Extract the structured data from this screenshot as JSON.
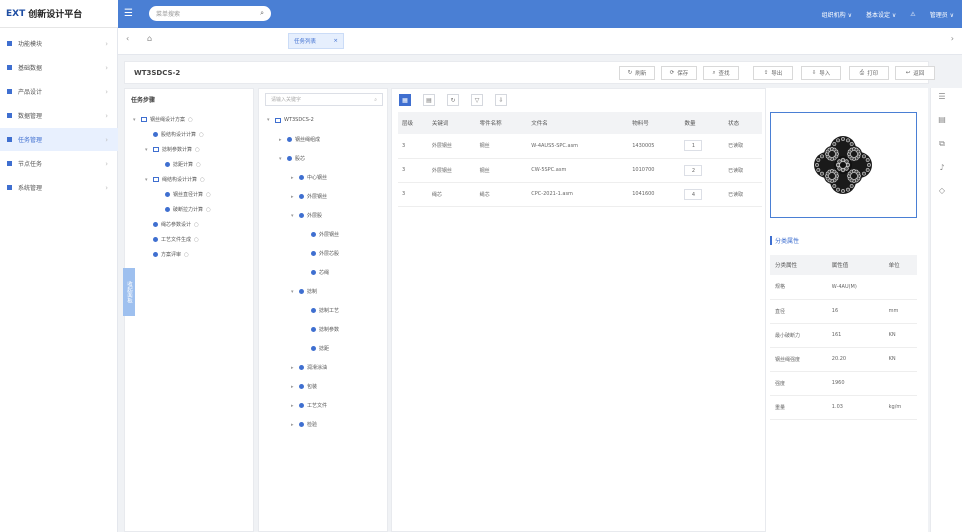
{
  "app": {
    "logo_mark": "EXT",
    "title": "创新设计平台"
  },
  "search": {
    "placeholder": "菜单搜索"
  },
  "topbar": {
    "items": [
      "组织机构 ∨",
      "基本设定 ∨",
      "管理员 ∨"
    ]
  },
  "sidebar": {
    "items": [
      {
        "label": "功能模块"
      },
      {
        "label": "基础数据"
      },
      {
        "label": "产品设计"
      },
      {
        "label": "数据管理"
      },
      {
        "label": "任务管理",
        "active": true
      },
      {
        "label": "节点任务"
      },
      {
        "label": "系统管理"
      }
    ]
  },
  "tabs": {
    "active_label": "任务列表"
  },
  "page": {
    "title": "WT3SDCS-2"
  },
  "toolbar": {
    "buttons": [
      "刷新",
      "保存",
      "查找",
      "导出",
      "导入",
      "打印",
      "返回"
    ]
  },
  "task_panel": {
    "title": "任务步骤",
    "vertical_tab": "收起面板",
    "nodes": [
      {
        "label": "钢丝绳设计方案",
        "depth": 0,
        "type": "folder",
        "caret": "▾"
      },
      {
        "label": "股结构设计计算",
        "depth": 1,
        "type": "dot"
      },
      {
        "label": "捻制参数计算",
        "depth": 1,
        "type": "folder",
        "caret": "▾"
      },
      {
        "label": "捻距计算",
        "depth": 2,
        "type": "dot"
      },
      {
        "label": "绳结构设计计算",
        "depth": 1,
        "type": "folder",
        "caret": "▾"
      },
      {
        "label": "钢丝直径计算",
        "depth": 2,
        "type": "dot"
      },
      {
        "label": "破断拉力计算",
        "depth": 2,
        "type": "dot"
      },
      {
        "label": "绳芯参数设计",
        "depth": 1,
        "type": "dot"
      },
      {
        "label": "工艺文件生成",
        "depth": 1,
        "type": "dot"
      },
      {
        "label": "方案评审",
        "depth": 1,
        "type": "dot"
      }
    ]
  },
  "struct_panel": {
    "filter_placeholder": "请输入关键字",
    "nodes": [
      {
        "label": "WT3SDCS-2",
        "depth": 0,
        "type": "folder",
        "caret": "▾"
      },
      {
        "label": "钢丝绳组成",
        "depth": 1,
        "type": "dot",
        "caret": "▸"
      },
      {
        "label": "股芯",
        "depth": 1,
        "type": "dot",
        "caret": "▾"
      },
      {
        "label": "中心钢丝",
        "depth": 2,
        "type": "dot",
        "caret": "▸"
      },
      {
        "label": "外层钢丝",
        "depth": 2,
        "type": "dot",
        "caret": "▸"
      },
      {
        "label": "外层股",
        "depth": 2,
        "type": "dot",
        "caret": "▾"
      },
      {
        "label": "外层钢丝",
        "depth": 3,
        "type": "dot"
      },
      {
        "label": "外层芯股",
        "depth": 3,
        "type": "dot"
      },
      {
        "label": "芯绳",
        "depth": 3,
        "type": "dot"
      },
      {
        "label": "捻制",
        "depth": 2,
        "type": "dot",
        "caret": "▾"
      },
      {
        "label": "捻制工艺",
        "depth": 3,
        "type": "dot"
      },
      {
        "label": "捻制参数",
        "depth": 3,
        "type": "dot"
      },
      {
        "label": "捻距",
        "depth": 3,
        "type": "dot"
      },
      {
        "label": "润滑涂油",
        "depth": 2,
        "type": "dot",
        "caret": "▸"
      },
      {
        "label": "包装",
        "depth": 2,
        "type": "dot",
        "caret": "▸"
      },
      {
        "label": "工艺文件",
        "depth": 2,
        "type": "dot",
        "caret": "▸"
      },
      {
        "label": "检验",
        "depth": 2,
        "type": "dot",
        "caret": "▸"
      }
    ]
  },
  "parts_table": {
    "headers": [
      "层级",
      "关键词",
      "零件名称",
      "文件名",
      "物料号",
      "数量",
      "状态"
    ],
    "rows": [
      [
        "3",
        "外层钢丝",
        "钢丝",
        "W-4AUS5-SPC.asm",
        "1430005",
        "1",
        "已读取"
      ],
      [
        "3",
        "外层钢丝",
        "钢丝",
        "CW-5SPC.asm",
        "1010700",
        "2",
        "已读取"
      ],
      [
        "3",
        "绳芯",
        "绳芯",
        "CPC-2021-1.asm",
        "1041600",
        "4",
        "已读取"
      ]
    ]
  },
  "properties": {
    "title": "分类属性",
    "headers": [
      "分类属性",
      "属性值",
      "单位"
    ],
    "rows": [
      [
        "规格",
        "W-4AU(M)",
        ""
      ],
      [
        "直径",
        "16",
        "mm"
      ],
      [
        "最小破断力",
        "161",
        "KN"
      ],
      [
        "钢丝绳强度",
        "20.20",
        "KN"
      ],
      [
        "强度",
        "1960",
        ""
      ],
      [
        "重量",
        "1.03",
        "kg/m"
      ]
    ]
  },
  "icons": {
    "search": "search-icon",
    "home": "home-icon",
    "close": "close-icon"
  }
}
